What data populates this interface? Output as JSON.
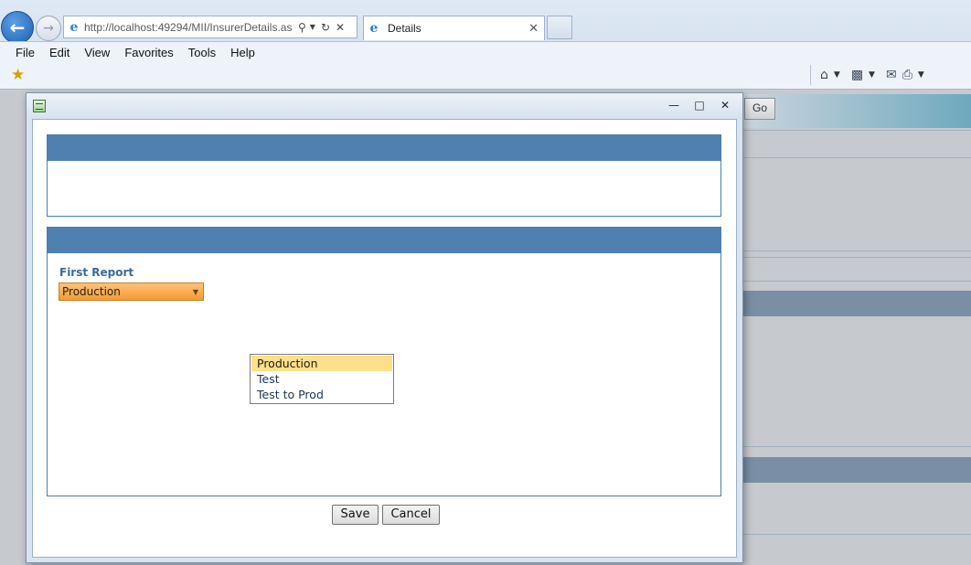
{
  "browser": {
    "url": "http://localhost:49294/MII/InsurerDetails.as",
    "tab_title": "Details",
    "menu": [
      "File",
      "Edit",
      "View",
      "Favorites",
      "Tools",
      "Help"
    ],
    "icons": {
      "back": "back-arrow-icon",
      "forward": "forward-arrow-icon",
      "search": "search-icon",
      "refresh": "refresh-icon",
      "stop": "stop-icon",
      "favorites": "favorites-star-icon",
      "home": "home-icon",
      "feeds": "rss-feed-icon",
      "mail": "mail-icon",
      "print": "print-icon"
    }
  },
  "background_page": {
    "go_label": "Go"
  },
  "dialog": {
    "field_label": "First Report",
    "select_value": "Production",
    "options": [
      "Production",
      "Test",
      "Test to Prod"
    ],
    "highlighted_option": "Production",
    "save_label": "Save",
    "cancel_label": "Cancel"
  },
  "colors": {
    "panel_header": "#5080b0",
    "select_fill": "#f59a2e",
    "option_highlight": "#ffe08a",
    "label_text": "#3a6a9a"
  }
}
